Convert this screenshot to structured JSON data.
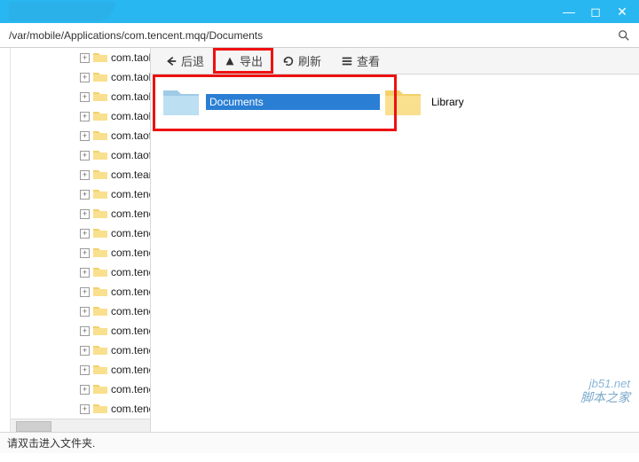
{
  "address_path": "/var/mobile/Applications/com.tencent.mqq/Documents",
  "toolbar": {
    "back": "后退",
    "export": "导出",
    "refresh": "刷新",
    "view": "查看"
  },
  "tree_items": [
    "com.taob",
    "com.taob",
    "com.taob",
    "com.taob",
    "com.taof",
    "com.taof",
    "com.tean",
    "com.tenc",
    "com.tenc",
    "com.tenc",
    "com.tenc",
    "com.tenc",
    "com.tenc",
    "com.tenc",
    "com.tenc",
    "com.tenc",
    "com.tenc",
    "com.tenc",
    "com.tenc"
  ],
  "folders": [
    {
      "name": "Documents",
      "selected": true
    },
    {
      "name": "Library",
      "selected": false
    }
  ],
  "status_text": "请双击进入文件夹.",
  "watermark": {
    "line1": "jb51.net",
    "line2": "脚本之家"
  }
}
